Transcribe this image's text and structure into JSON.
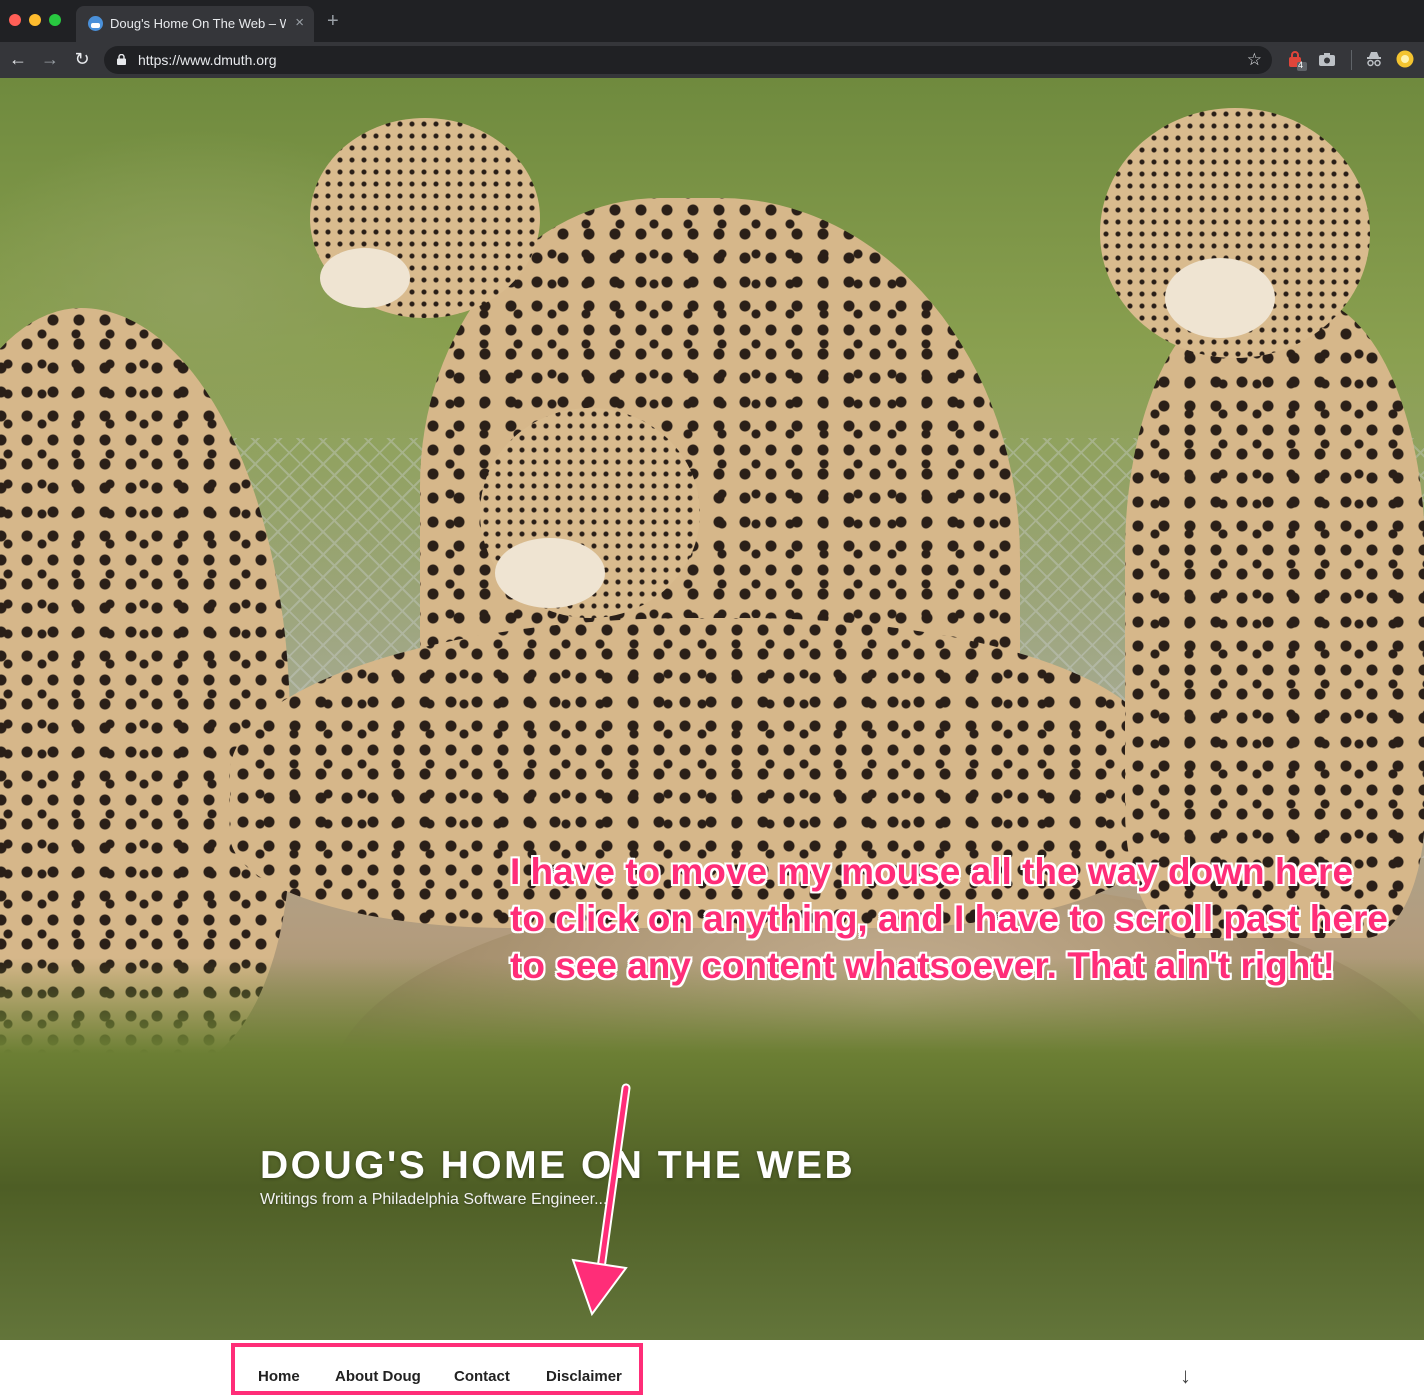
{
  "browser": {
    "tab_title": "Doug's Home On The Web – W",
    "tab_close": "×",
    "new_tab": "+",
    "url": "https://www.dmuth.org",
    "back_icon": "←",
    "forward_icon": "→",
    "reload_icon": "↻",
    "star_icon": "☆",
    "extension_badge": "4"
  },
  "site": {
    "title": "DOUG'S HOME ON THE WEB",
    "tagline": "Writings from a Philadelphia Software Engineer..."
  },
  "annotation": {
    "lines": [
      "I have to move my mouse all the way down here",
      "to click on anything, and I have to scroll past here",
      "to see any content whatsoever. That ain't right!"
    ],
    "color": "#ff2d78"
  },
  "nav": {
    "items": [
      "Home",
      "About Doug",
      "Contact",
      "Disclaimer"
    ],
    "scroll_icon": "↓"
  },
  "colors": {
    "chrome_dark": "#202124",
    "chrome_toolbar": "#35363a",
    "highlight": "#ff2d78"
  }
}
